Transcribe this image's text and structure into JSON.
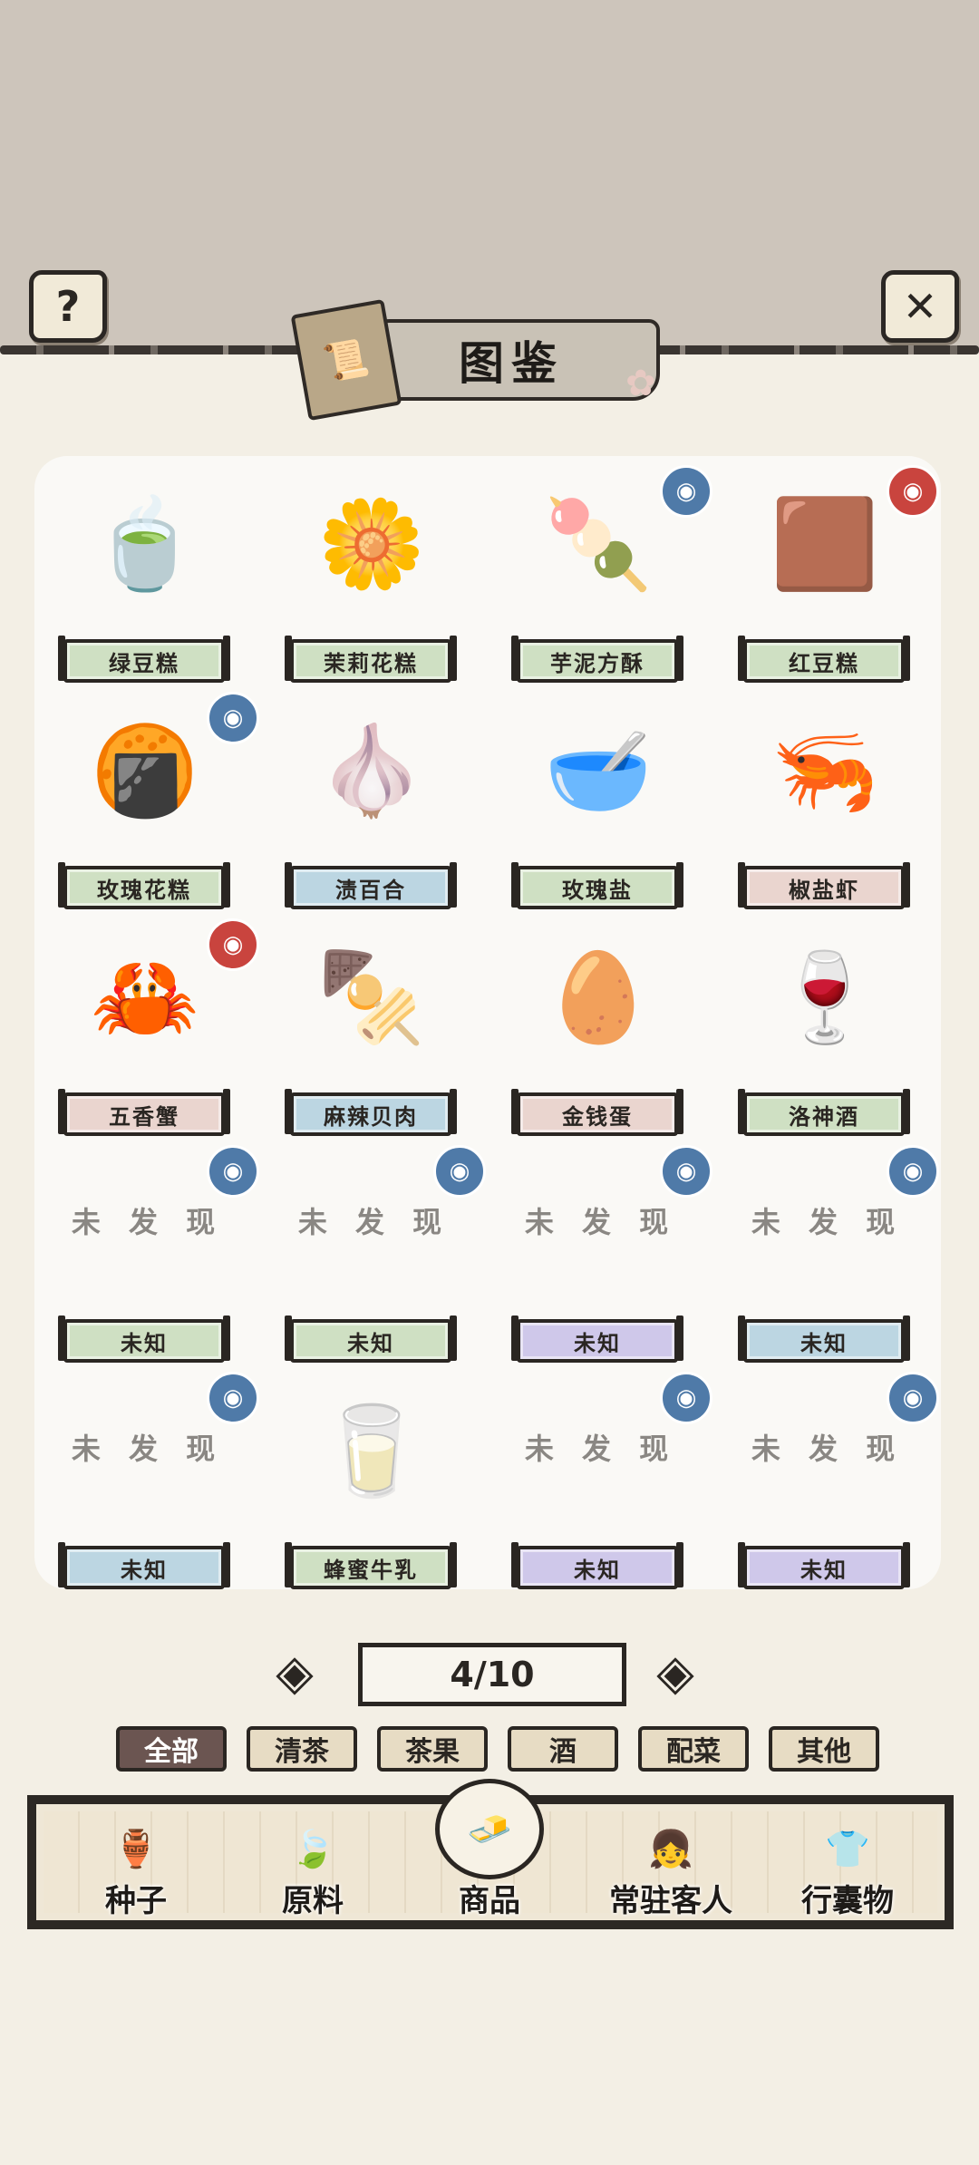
{
  "header": {
    "title": "图鉴",
    "help_label": "?",
    "close_label": "✕"
  },
  "grid": {
    "undiscovered_text": "未 发 现",
    "items": [
      {
        "name": "绿豆糕",
        "discovered": true,
        "dish_icon": "🍵",
        "tag_color": "#cfe0c3",
        "badge": null
      },
      {
        "name": "茉莉花糕",
        "discovered": true,
        "dish_icon": "🌼",
        "tag_color": "#cfe0c3",
        "badge": null
      },
      {
        "name": "芋泥方酥",
        "discovered": true,
        "dish_icon": "🍡",
        "tag_color": "#cfe0c3",
        "badge": "blue"
      },
      {
        "name": "红豆糕",
        "discovered": true,
        "dish_icon": "🟫",
        "tag_color": "#cfe0c3",
        "badge": "red"
      },
      {
        "name": "玫瑰花糕",
        "discovered": true,
        "dish_icon": "🍘",
        "tag_color": "#cfe0c3",
        "badge": "blue"
      },
      {
        "name": "渍百合",
        "discovered": true,
        "dish_icon": "🧄",
        "tag_color": "#bcd6e2",
        "badge": null
      },
      {
        "name": "玫瑰盐",
        "discovered": true,
        "dish_icon": "🥣",
        "tag_color": "#cfe0c3",
        "badge": null
      },
      {
        "name": "椒盐虾",
        "discovered": true,
        "dish_icon": "🦐",
        "tag_color": "#ead5cf",
        "badge": null
      },
      {
        "name": "五香蟹",
        "discovered": true,
        "dish_icon": "🦀",
        "tag_color": "#ead5cf",
        "badge": "red"
      },
      {
        "name": "麻辣贝肉",
        "discovered": true,
        "dish_icon": "🍢",
        "tag_color": "#bcd6e2",
        "badge": null
      },
      {
        "name": "金钱蛋",
        "discovered": true,
        "dish_icon": "🥚",
        "tag_color": "#ead5cf",
        "badge": null
      },
      {
        "name": "洛神酒",
        "discovered": true,
        "dish_icon": "🍷",
        "tag_color": "#cfe0c3",
        "badge": null
      },
      {
        "name": "未知",
        "discovered": false,
        "dish_icon": "",
        "tag_color": "#cfe0c3",
        "badge": "blue"
      },
      {
        "name": "未知",
        "discovered": false,
        "dish_icon": "",
        "tag_color": "#cfe0c3",
        "badge": "blue"
      },
      {
        "name": "未知",
        "discovered": false,
        "dish_icon": "",
        "tag_color": "#cfc8ea",
        "badge": "blue"
      },
      {
        "name": "未知",
        "discovered": false,
        "dish_icon": "",
        "tag_color": "#bcd6e2",
        "badge": "blue"
      },
      {
        "name": "未知",
        "discovered": false,
        "dish_icon": "",
        "tag_color": "#bcd6e2",
        "badge": "blue"
      },
      {
        "name": "蜂蜜牛乳",
        "discovered": true,
        "dish_icon": "🥛",
        "tag_color": "#cfe0c3",
        "badge": null
      },
      {
        "name": "未知",
        "discovered": false,
        "dish_icon": "",
        "tag_color": "#cfc8ea",
        "badge": "blue"
      },
      {
        "name": "未知",
        "discovered": false,
        "dish_icon": "",
        "tag_color": "#cfc8ea",
        "badge": "blue"
      }
    ]
  },
  "pager": {
    "text": "4/10",
    "prev_label": "◈",
    "next_label": "◈"
  },
  "filters": [
    "全部",
    "清茶",
    "茶果",
    "酒",
    "配菜",
    "其他"
  ],
  "active_filter_index": 0,
  "nav": {
    "items": [
      {
        "label": "种子",
        "icon": "🏺"
      },
      {
        "label": "原料",
        "icon": "🍃"
      },
      {
        "label": "商品",
        "icon": "🧈"
      },
      {
        "label": "常驻客人",
        "icon": "👧"
      },
      {
        "label": "行囊物",
        "icon": "👕"
      }
    ],
    "active_index": 2
  },
  "colors": {
    "badge_blue": "#4f7aa8",
    "badge_red": "#c9443e",
    "panel": "#faf9f6",
    "background": "#f3efe5"
  }
}
